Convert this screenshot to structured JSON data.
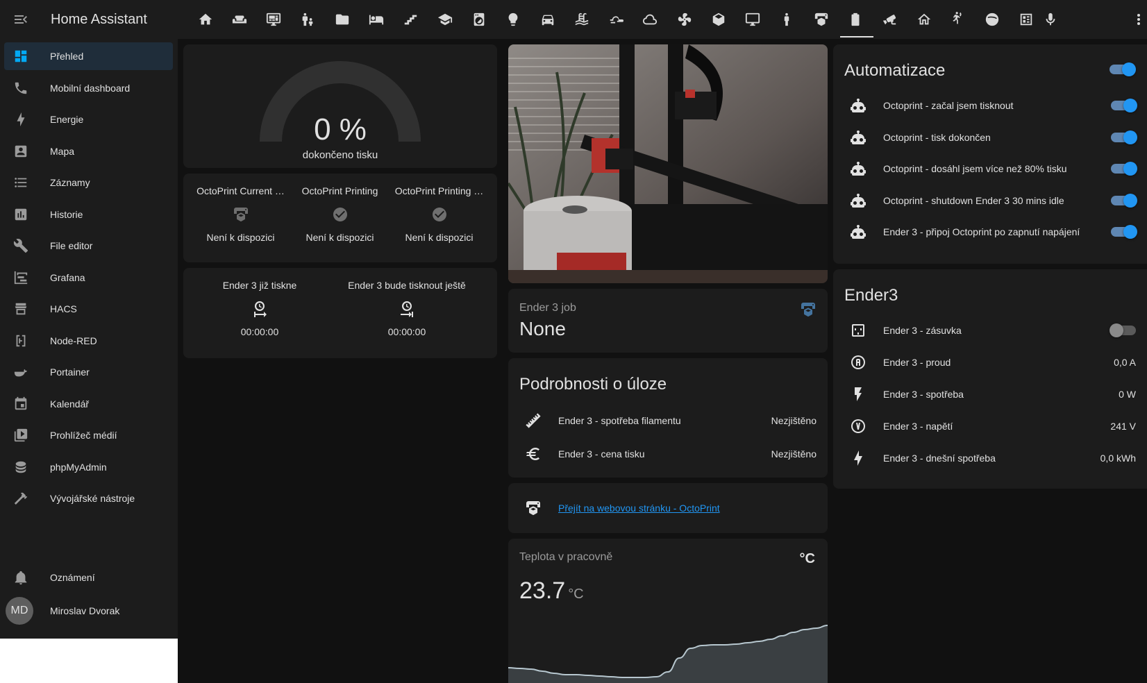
{
  "sidebar": {
    "title": "Home Assistant",
    "items": [
      {
        "label": "Přehled",
        "icon": "dashboard-icon",
        "active": true
      },
      {
        "label": "Mobilní dashboard",
        "icon": "phone-icon"
      },
      {
        "label": "Energie",
        "icon": "lightning-icon"
      },
      {
        "label": "Mapa",
        "icon": "account-box-icon"
      },
      {
        "label": "Záznamy",
        "icon": "list-icon"
      },
      {
        "label": "Historie",
        "icon": "chart-box-icon"
      },
      {
        "label": "File editor",
        "icon": "wrench-icon"
      },
      {
        "label": "Grafana",
        "icon": "chart-timeline-icon"
      },
      {
        "label": "HACS",
        "icon": "hacs-icon"
      },
      {
        "label": "Node-RED",
        "icon": "sitemap-icon"
      },
      {
        "label": "Portainer",
        "icon": "docker-icon"
      },
      {
        "label": "Kalendář",
        "icon": "calendar-icon"
      },
      {
        "label": "Prohlížeč médií",
        "icon": "play-box-icon"
      },
      {
        "label": "phpMyAdmin",
        "icon": "database-icon"
      },
      {
        "label": "Vývojářské nástroje",
        "icon": "hammer-icon"
      }
    ],
    "notifications": {
      "label": "Oznámení",
      "icon": "bell-icon"
    },
    "user": {
      "initials": "MD",
      "name": "Miroslav Dvorak"
    }
  },
  "topbar": {
    "tabs": [
      "home-icon",
      "sofa-icon",
      "monitor-dashboard-icon",
      "human-male-child-icon",
      "folder-icon",
      "bed-icon",
      "stairs-icon",
      "school-icon",
      "washing-machine-icon",
      "lightbulb-icon",
      "car-icon",
      "pool-icon",
      "weather-icon",
      "cloud-icon",
      "air-conditioner-icon",
      "cube-icon",
      "desk-icon",
      "human-icon",
      "printer-3d-icon",
      "battery-icon",
      "cctv-icon",
      "home-roof-icon",
      "motion-sensor-icon",
      "spotify-icon",
      "smart-meter-icon",
      "microphone-icon"
    ],
    "active_tab": "printer-3d-icon"
  },
  "gauge": {
    "value": "0 %",
    "label": "dokončeno tisku",
    "fraction": 0
  },
  "glance_octoprint": {
    "items": [
      {
        "name": "OctoPrint Current …",
        "state": "Není k dispozici",
        "icon": "printer-3d-icon"
      },
      {
        "name": "OctoPrint Printing",
        "state": "Není k dispozici",
        "icon": "check-circle-icon"
      },
      {
        "name": "OctoPrint Printing …",
        "state": "Není k dispozici",
        "icon": "check-circle-icon"
      }
    ]
  },
  "glance_times": {
    "items": [
      {
        "name": "Ender 3 již tiskne",
        "state": "00:00:00",
        "icon": "timer-start-icon"
      },
      {
        "name": "Ender 3 bude tisknout ještě",
        "state": "00:00:00",
        "icon": "timer-end-icon"
      }
    ]
  },
  "job": {
    "label": "Ender 3 job",
    "value": "None"
  },
  "details": {
    "title": "Podrobnosti o úloze",
    "rows": [
      {
        "name": "Ender 3 - spotřeba filamentu",
        "state": "Nezjištěno",
        "icon": "ruler-icon"
      },
      {
        "name": "Ender 3 - cena tisku",
        "state": "Nezjištěno",
        "icon": "euro-icon"
      }
    ]
  },
  "weblink": {
    "label": "Přejít na webovou stránku - OctoPrint"
  },
  "temperature": {
    "title": "Teplota v pracovně",
    "value": "23.7",
    "unit": "°C",
    "icon_label": "°C",
    "history": [
      0.22,
      0.21,
      0.2,
      0.17,
      0.14,
      0.12,
      0.12,
      0.11,
      0.1,
      0.09,
      0.08,
      0.08,
      0.08,
      0.09,
      0.16,
      0.36,
      0.5,
      0.54,
      0.55,
      0.55,
      0.56,
      0.58,
      0.6,
      0.63,
      0.68,
      0.73,
      0.77,
      0.79,
      0.83
    ]
  },
  "automations": {
    "title": "Automatizace",
    "header_toggle": true,
    "rows": [
      {
        "name": "Octoprint - začal jsem tisknout",
        "on": true
      },
      {
        "name": "Octoprint - tisk dokončen",
        "on": true
      },
      {
        "name": "Octoprint - dosáhl jsem více než 80% tisku",
        "on": true
      },
      {
        "name": "Octoprint - shutdown Ender 3 30 mins idle",
        "on": true
      },
      {
        "name": "Ender 3 - připoj Octoprint po zapnutí napájení",
        "on": true
      }
    ]
  },
  "ender3": {
    "title": "Ender3",
    "rows": [
      {
        "name": "Ender 3 - zásuvka",
        "state": "",
        "icon": "power-socket-icon",
        "toggle": false
      },
      {
        "name": "Ender 3 - proud",
        "state": "0,0 A",
        "icon": "alpha-a-circle-icon"
      },
      {
        "name": "Ender 3 - spotřeba",
        "state": "0 W",
        "icon": "flash-icon"
      },
      {
        "name": "Ender 3 - napětí",
        "state": "241 V",
        "icon": "alpha-v-circle-icon"
      },
      {
        "name": "Ender 3 - dnešní spotřeba",
        "state": "0,0 kWh",
        "icon": "lightning-bolt-icon"
      }
    ]
  },
  "colors": {
    "accent": "#2196f3",
    "card_bg": "#1c1c1c",
    "page_bg": "#111111",
    "active_nav": "#03a9f4"
  }
}
